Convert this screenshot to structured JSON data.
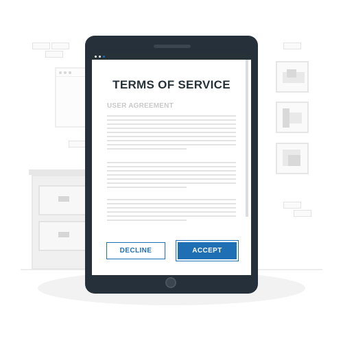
{
  "document": {
    "title": "TERMS OF SERVICE",
    "subtitle": "USER AGREEMENT"
  },
  "actions": {
    "decline_label": "DECLINE",
    "accept_label": "ACCEPT"
  },
  "colors": {
    "accent": "#1f6fb5",
    "device_body": "#26303a",
    "text_dark": "#263238",
    "text_muted": "#c9c9c9"
  }
}
